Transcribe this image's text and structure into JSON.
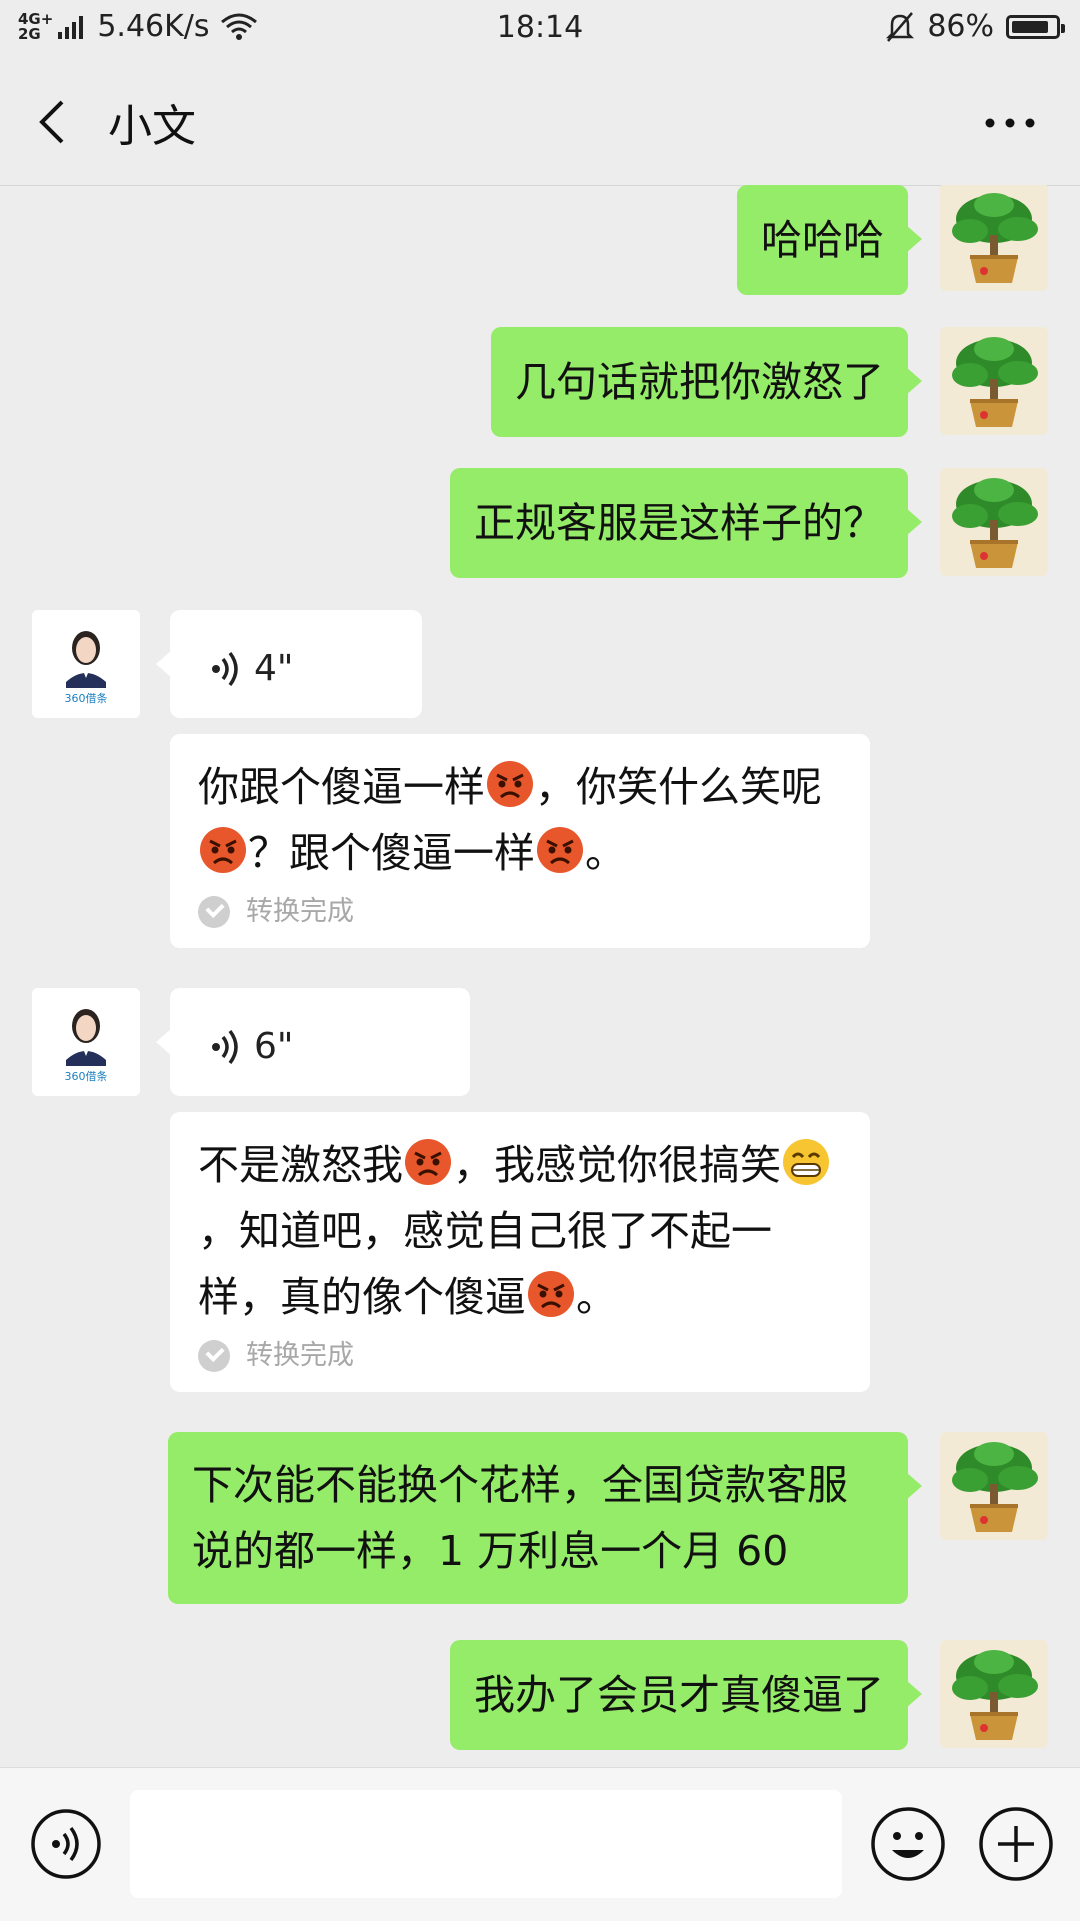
{
  "status_bar": {
    "network_top": "4G+",
    "network_bottom": "2G",
    "speed": "5.46K/s",
    "time": "18:14",
    "battery": "86%",
    "battery_level": 0.86
  },
  "header": {
    "title": "小文"
  },
  "messages": [
    {
      "side": "out",
      "text": "哈哈哈"
    },
    {
      "side": "out",
      "text": "几句话就把你激怒了"
    },
    {
      "side": "out",
      "text": "正规客服是这样子的？"
    },
    {
      "side": "in",
      "type": "voice",
      "duration": "4\""
    },
    {
      "side": "in",
      "type": "transcript",
      "parts": [
        "你跟个傻逼一样",
        "angry-emoji",
        "，你笑什么笑呢",
        "angry-emoji",
        "？跟个傻逼一样",
        "angry-emoji",
        "。"
      ],
      "status": "转换完成"
    },
    {
      "side": "in",
      "type": "voice",
      "duration": "6\""
    },
    {
      "side": "in",
      "type": "transcript",
      "parts": [
        "不是激怒我",
        "angry-emoji",
        "，我感觉你很搞笑",
        "grin-emoji",
        "，知道吧，感觉自己很了不起一样，真的像个傻逼",
        "angry-emoji",
        "。"
      ],
      "status": "转换完成"
    },
    {
      "side": "out",
      "text": "下次能不能换个花样，全国贷款客服说的都一样，1 万利息一个月 60"
    },
    {
      "side": "out",
      "text": "我办了会员才真傻逼了"
    }
  ],
  "avatars": {
    "self": "plant-avatar",
    "other": "woman-avatar",
    "other_logo_text": "360借条"
  },
  "colors": {
    "outgoing_bubble": "#95ec69",
    "incoming_bubble": "#ffffff",
    "background": "#ededed"
  }
}
